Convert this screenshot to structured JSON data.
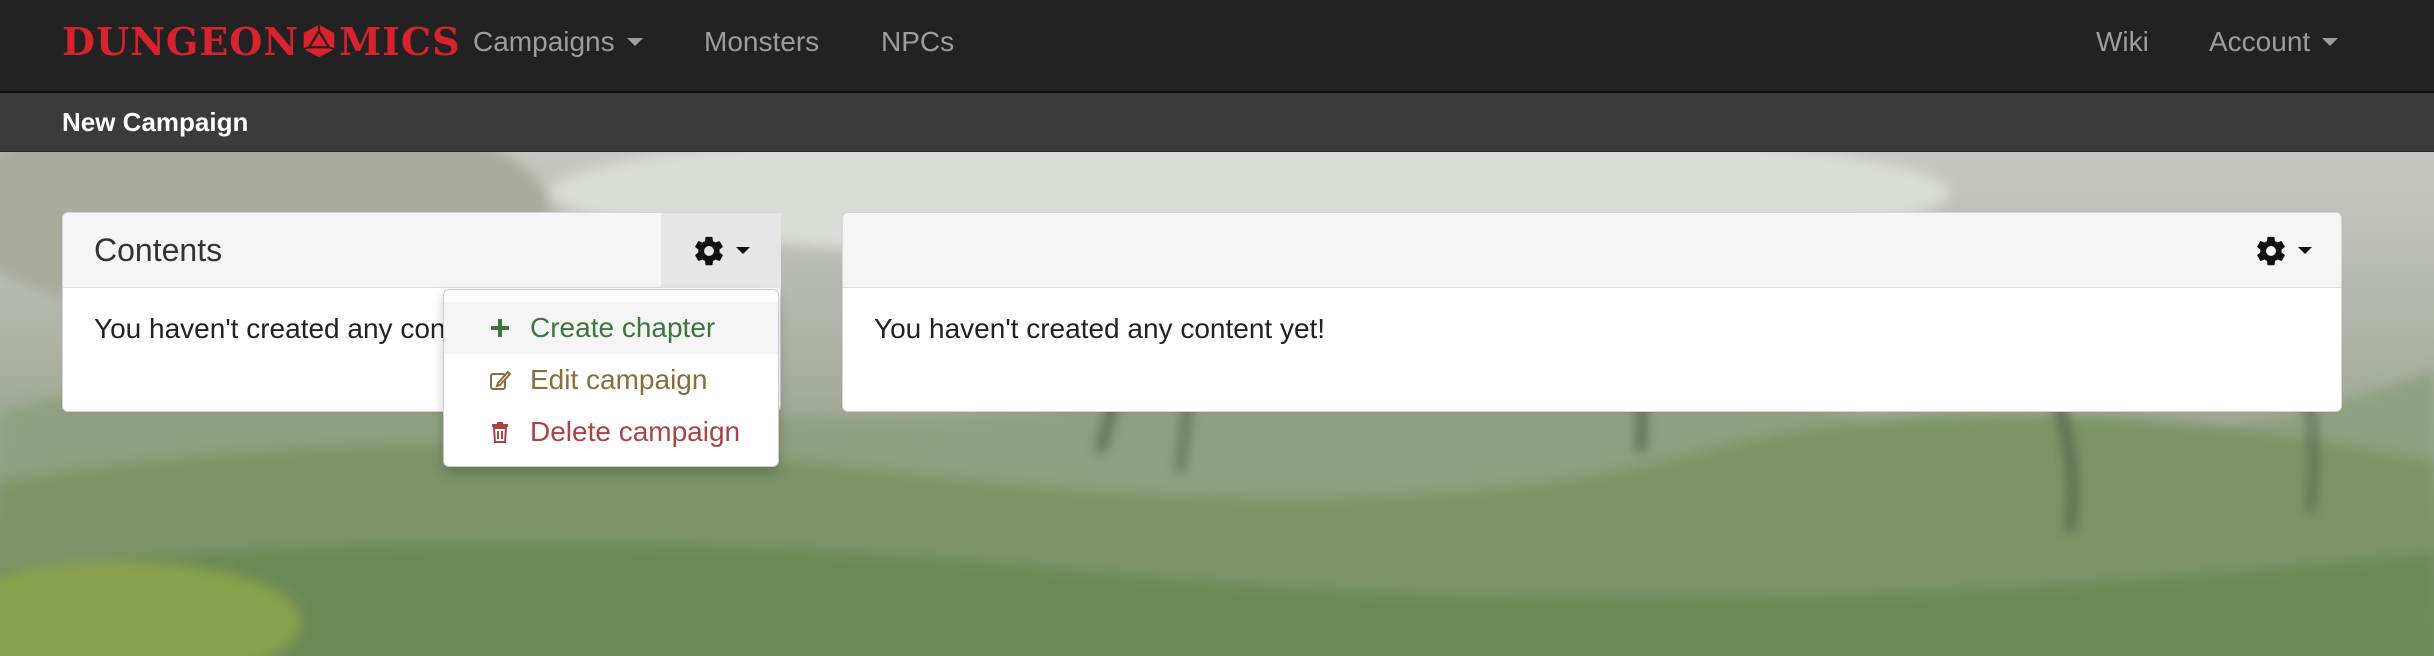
{
  "navbar": {
    "brand_left": "DUNGEON",
    "brand_right": "MICS",
    "links": [
      {
        "label": "Campaigns",
        "dropdown": true
      },
      {
        "label": "Monsters",
        "dropdown": false
      },
      {
        "label": "NPCs",
        "dropdown": false
      },
      {
        "label": "Wiki",
        "dropdown": false
      },
      {
        "label": "Account",
        "dropdown": true
      }
    ]
  },
  "subbar": {
    "title": "New Campaign"
  },
  "left_panel": {
    "title": "Contents",
    "body_text": "You haven't created any con"
  },
  "right_panel": {
    "title": "",
    "body_text": "You haven't created any content yet!"
  },
  "dropdown_menu": {
    "items": [
      {
        "label": "Create chapter",
        "icon": "plus-icon",
        "color": "#3c763d"
      },
      {
        "label": "Edit campaign",
        "icon": "edit-icon",
        "color": "#8a6d3b"
      },
      {
        "label": "Delete campaign",
        "icon": "trash-icon",
        "color": "#a94442"
      }
    ]
  },
  "colors": {
    "brand": "#d8232f",
    "navbar_bg": "#222222",
    "subbar_bg": "#3b3b3b"
  }
}
